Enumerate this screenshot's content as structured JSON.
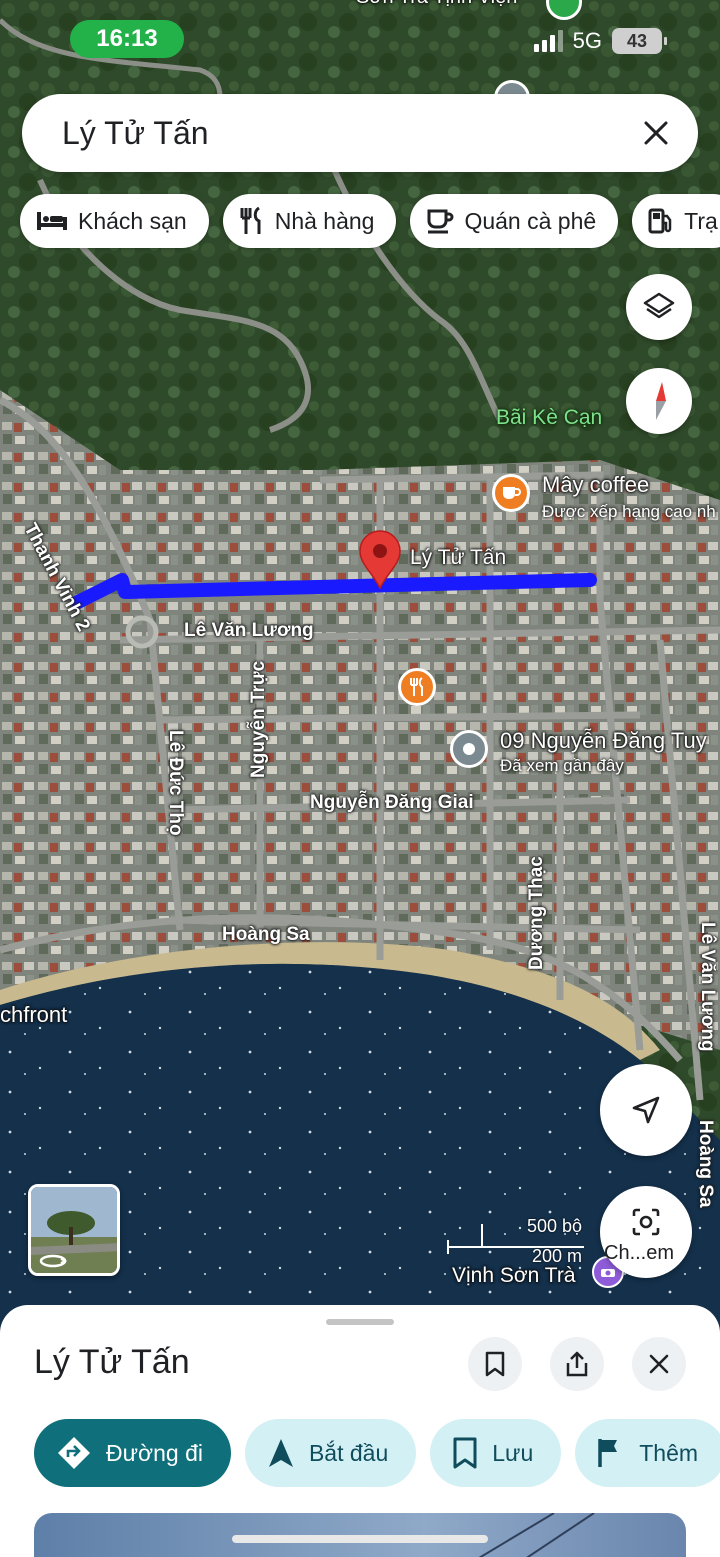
{
  "status_bar": {
    "time": "16:13",
    "network": "5G",
    "battery": "43"
  },
  "search": {
    "query": "Lý Tử Tấn"
  },
  "chips": [
    {
      "label": "Khách sạn",
      "icon": "bed-icon"
    },
    {
      "label": "Nhà hàng",
      "icon": "restaurant-icon"
    },
    {
      "label": "Quán cà phê",
      "icon": "coffee-icon"
    },
    {
      "label": "Trạ",
      "icon": "gas-station-icon"
    }
  ],
  "map": {
    "top_label": "Sơn Trà Tịnh Viện",
    "streets": {
      "thanh_vinh": "Thanh Vinh 2",
      "le_van_luong": "Lê Văn Lương",
      "nguyen_truc": "Nguyễn Trực",
      "le_duc_tho": "Lê Đức Thọ",
      "nguyen_dang_giai": "Nguyễn Đăng Giai",
      "hoang_sa": "Hoàng Sa",
      "duong_thac": "Dương Thạc",
      "le_van_luong_right": "Lê Văn Lương",
      "hoang_sa_right": "Hoàng Sa"
    },
    "pois": {
      "bai_ke_can": "Bãi Kè Cạn",
      "may_coffee": "Mây coffee",
      "may_coffee_sub": "Được xếp hạng cao nh",
      "selected_pin": "Lý Tử Tấn",
      "recent_place": "09 Nguyễn Đăng Tuy",
      "recent_place_sub": "Đã xem gần đây",
      "beachfront": "chfront",
      "vinh_son_tra": "Vịnh Sơn Trà"
    },
    "scale": {
      "imperial": "500 bộ",
      "metric": "200 m"
    },
    "lens_label": "Ch...em",
    "route_color": "#1a1aff",
    "pin_color": "#e53935"
  },
  "sheet": {
    "title": "Lý Tử Tấn",
    "actions": [
      {
        "label": "Đường đi",
        "icon": "directions-icon"
      },
      {
        "label": "Bắt đầu",
        "icon": "navigation-arrow-icon"
      },
      {
        "label": "Lưu",
        "icon": "bookmark-icon"
      },
      {
        "label": "Thêm",
        "icon": "flag-icon"
      }
    ]
  }
}
